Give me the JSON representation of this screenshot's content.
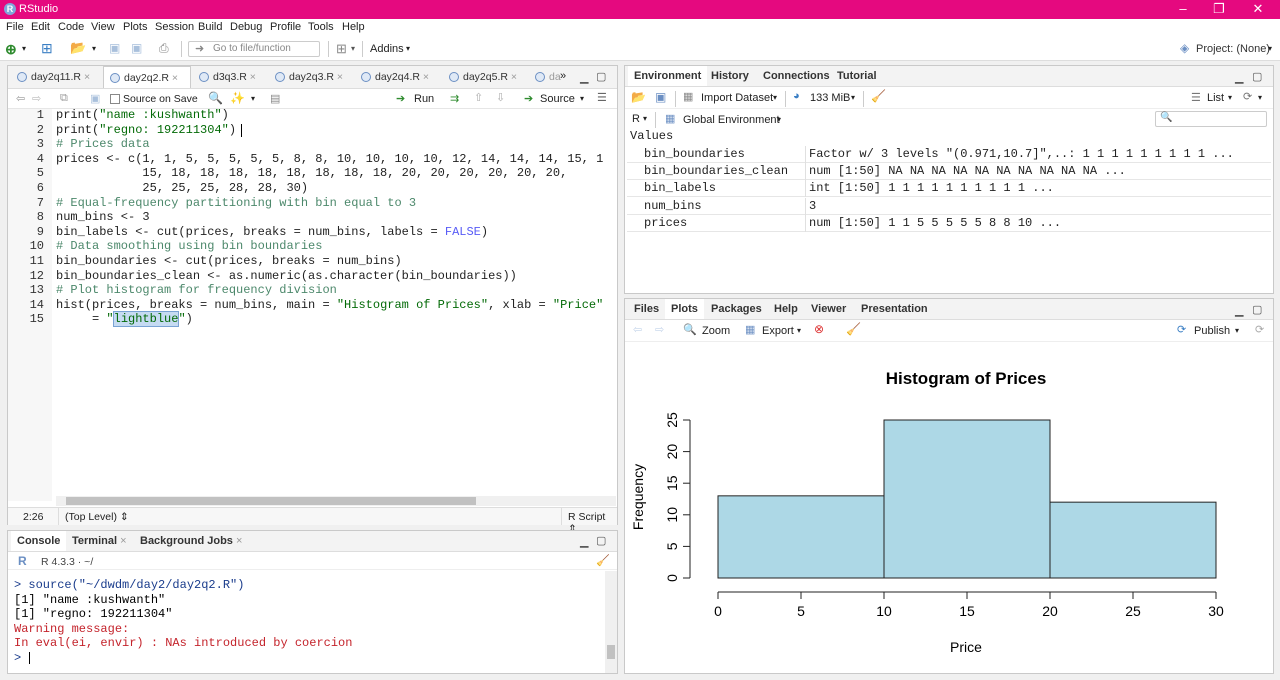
{
  "window": {
    "title": "RStudio"
  },
  "menu": [
    "File",
    "Edit",
    "Code",
    "View",
    "Plots",
    "Session",
    "Build",
    "Debug",
    "Profile",
    "Tools",
    "Help"
  ],
  "toolbar": {
    "goto_placeholder": "Go to file/function",
    "addins": "Addins",
    "project": "Project: (None)"
  },
  "editor": {
    "tabs": [
      "day2q11.R",
      "day2q2.R",
      "d3q3.R",
      "day2q3.R",
      "day2q4.R",
      "day2q5.R",
      "da"
    ],
    "active_tab": 1,
    "source_on_save": "Source on Save",
    "run_label": "Run",
    "source_label": "Source",
    "lines": [
      {
        "n": "1",
        "text": "print(\"name :kushwanth\")"
      },
      {
        "n": "2",
        "text": "print(\"regno: 192211304\")"
      },
      {
        "n": "3",
        "text": "# Prices data"
      },
      {
        "n": "4",
        "text": "prices <- c(1, 1, 5, 5, 5, 5, 5, 8, 8, 10, 10, 10, 10, 12, 14, 14, 14, 15, 1"
      },
      {
        "n": "5",
        "text": "            15, 18, 18, 18, 18, 18, 18, 18, 18, 20, 20, 20, 20, 20, 20,"
      },
      {
        "n": "6",
        "text": "            25, 25, 25, 28, 28, 30)"
      },
      {
        "n": "7",
        "text": "# Equal-frequency partitioning with bin equal to 3"
      },
      {
        "n": "8",
        "text": "num_bins <- 3"
      },
      {
        "n": "9",
        "text": "bin_labels <- cut(prices, breaks = num_bins, labels = FALSE)"
      },
      {
        "n": "10",
        "text": "# Data smoothing using bin boundaries"
      },
      {
        "n": "11",
        "text": "bin_boundaries <- cut(prices, breaks = num_bins)"
      },
      {
        "n": "12",
        "text": "bin_boundaries_clean <- as.numeric(as.character(bin_boundaries))"
      },
      {
        "n": "13",
        "text": "# Plot histogram for frequency division"
      },
      {
        "n": "14",
        "text": "hist(prices, breaks = num_bins, main = \"Histogram of Prices\", xlab = \"Price\""
      },
      {
        "n": "15",
        "text": "     = \"lightblue\")"
      }
    ],
    "status": {
      "pos": "2:26",
      "scope": "(Top Level)",
      "type": "R Script"
    }
  },
  "console": {
    "tabs": [
      "Console",
      "Terminal",
      "Background Jobs"
    ],
    "r_version": "R 4.3.3 · ~/",
    "lines": [
      {
        "text": "> source(\"~/dwdm/day2/day2q2.R\")",
        "kind": "cmd"
      },
      {
        "text": "[1] \"name :kushwanth\"",
        "kind": "out"
      },
      {
        "text": "[1] \"regno: 192211304\"",
        "kind": "out"
      },
      {
        "text": "Warning message:",
        "kind": "warn"
      },
      {
        "text": "In eval(ei, envir) : NAs introduced by coercion",
        "kind": "warn"
      },
      {
        "text": "> ",
        "kind": "cmd"
      }
    ]
  },
  "environment": {
    "tabs": [
      "Environment",
      "History",
      "Connections",
      "Tutorial"
    ],
    "import_label": "Import Dataset",
    "memory": "133 MiB",
    "list_label": "List",
    "lang": "R",
    "scope": "Global Environment",
    "section": "Values",
    "rows": [
      {
        "name": "bin_boundaries",
        "value": "Factor w/ 3 levels \"(0.971,10.7]\",..: 1 1 1 1 1 1 1 1 1 ..."
      },
      {
        "name": "bin_boundaries_clean",
        "value": "num [1:50] NA NA NA NA NA NA NA NA NA NA ..."
      },
      {
        "name": "bin_labels",
        "value": "int [1:50] 1 1 1 1 1 1 1 1 1 1 ..."
      },
      {
        "name": "num_bins",
        "value": "3"
      },
      {
        "name": "prices",
        "value": "num [1:50] 1 1 5 5 5 5 5 8 8 10 ..."
      }
    ]
  },
  "files": {
    "tabs": [
      "Files",
      "Plots",
      "Packages",
      "Help",
      "Viewer",
      "Presentation"
    ],
    "zoom": "Zoom",
    "export": "Export",
    "publish": "Publish"
  },
  "chart_data": {
    "type": "bar",
    "title": "Histogram of Prices",
    "xlabel": "Price",
    "ylabel": "Frequency",
    "bins": [
      {
        "x0": 0,
        "x1": 10,
        "count": 13
      },
      {
        "x0": 10,
        "x1": 20,
        "count": 25
      },
      {
        "x0": 20,
        "x1": 30,
        "count": 12
      }
    ],
    "xticks": [
      "0",
      "5",
      "10",
      "15",
      "20",
      "25",
      "30"
    ],
    "yticks": [
      "0",
      "5",
      "10",
      "15",
      "20",
      "25"
    ],
    "xlim": [
      0,
      30
    ],
    "ylim": [
      0,
      25
    ],
    "fill": "#add8e6"
  }
}
